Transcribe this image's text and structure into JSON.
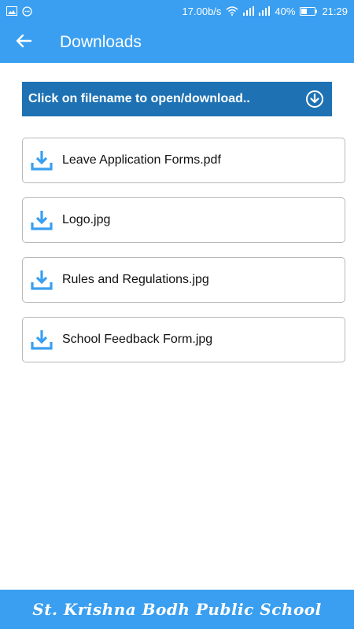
{
  "status_bar": {
    "network_speed": "17.00b/s",
    "battery": "40%",
    "time": "21:29",
    "icons": [
      "image-icon",
      "chat-icon",
      "wifi-icon",
      "signal-icon",
      "signal-icon",
      "battery-icon"
    ]
  },
  "app_bar": {
    "title": "Downloads",
    "back_icon": "arrow-left-icon"
  },
  "banner": {
    "text": "Click on filename to open/download..",
    "icon": "download-circle-icon"
  },
  "files": [
    {
      "name": "Leave Application Forms.pdf",
      "icon": "download-icon"
    },
    {
      "name": "Logo.jpg",
      "icon": "download-icon"
    },
    {
      "name": "Rules and Regulations.jpg",
      "icon": "download-icon"
    },
    {
      "name": "School Feedback Form.jpg",
      "icon": "download-icon"
    }
  ],
  "footer": {
    "school_name": "St. Krishna Bodh Public School"
  },
  "colors": {
    "primary": "#3a9ff0",
    "banner": "#1e72b3",
    "download_icon": "#3a9ff0",
    "item_border": "#b8b8b8"
  }
}
